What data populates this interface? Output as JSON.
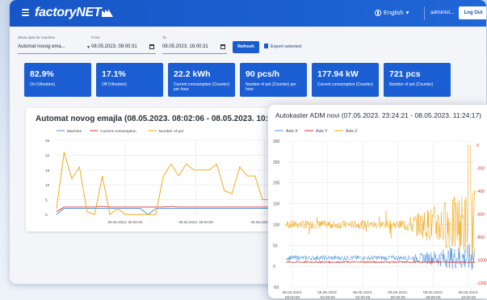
{
  "header": {
    "brand_text": "factoryNET",
    "language": "English",
    "user": "administ...",
    "logout": "Log Out"
  },
  "filters": {
    "machine": {
      "label": "Show data for machine",
      "value": "Automat novog ema..."
    },
    "from": {
      "label": "From",
      "value": "08.05.2023. 08:00:31"
    },
    "to": {
      "label": "To",
      "value": "08.05.2023. 16:00:31"
    },
    "refresh": "Refresh",
    "export": "Export selected"
  },
  "kpis": [
    {
      "value": "82.9%",
      "label": "On (Vibration)"
    },
    {
      "value": "17.1%",
      "label": "Off (Vibration)"
    },
    {
      "value": "22.2 kWh",
      "label": "Current consumption (Counter) per hour"
    },
    {
      "value": "90 pcs/h",
      "label": "Number of pot (Counter) per hour"
    },
    {
      "value": "177.94 kW",
      "label": "Current consumption (Counter)"
    },
    {
      "value": "721 pcs",
      "label": "Number of pot (Counter)"
    }
  ],
  "colors": {
    "primary": "#1b5ed4",
    "blue_series": "#4a90e2",
    "red_series": "#d9302b",
    "orange_series": "#f0a30a"
  },
  "chart_data": [
    {
      "type": "line",
      "title": "Automat novog emajla (08.05.2023. 08:02:06 - 08.05.2023. 10:20:08)",
      "series": [
        {
          "name": "Machine",
          "color": "#4a90e2",
          "values": [
            0,
            2,
            2,
            2,
            2,
            2,
            2,
            2,
            2,
            2,
            2,
            2,
            0,
            2,
            2,
            2,
            2,
            2,
            2,
            2,
            2,
            2,
            2,
            2,
            2,
            2,
            2,
            2,
            2,
            2
          ]
        },
        {
          "name": "Current consumption",
          "color": "#d9302b",
          "values": [
            1,
            2.5,
            2.5,
            2.5,
            2.5,
            2.5,
            2.7,
            2.5,
            2.5,
            2.5,
            2.5,
            2.5,
            2.5,
            2.5,
            2.5,
            2.7,
            2.5,
            2.5,
            2.5,
            2.5,
            2.5,
            2.5,
            2.5,
            2.5,
            2.5,
            2.5,
            2.5,
            2.5,
            2.5,
            2.5
          ]
        },
        {
          "name": "Number of pot",
          "color": "#f0a30a",
          "values": [
            2,
            21,
            12,
            16,
            1,
            0,
            13,
            0,
            2,
            0,
            0,
            0,
            0,
            0,
            13,
            17,
            13,
            17,
            15,
            15,
            15,
            17,
            8,
            7,
            16,
            13,
            13,
            5,
            5,
            12
          ]
        }
      ],
      "x_ticks": [
        "08.05.2023. 08:30:00",
        "08.05.2023. 09:00:00",
        "08.05.2023. 09:3"
      ],
      "ylim": [
        0,
        25
      ],
      "y_ticks": [
        0,
        5,
        10,
        15,
        20,
        25
      ]
    },
    {
      "type": "line",
      "title": "Autokaster ADM novi (07.05.2023. 23:24:21 - 08.05.2023. 11:24:17)",
      "series": [
        {
          "name": "Axis X",
          "color": "#4a90e2"
        },
        {
          "name": "Axis Y",
          "color": "#d9302b"
        },
        {
          "name": "Axis Z",
          "color": "#f0a30a"
        }
      ],
      "ylim": [
        -50,
        300
      ],
      "y_ticks": [
        -50,
        0,
        50,
        100,
        150,
        200,
        250,
        300
      ],
      "y2_ticks": [
        0,
        -200,
        -400,
        -600,
        -800,
        -1000,
        -1200
      ],
      "x_ticks": [
        "08.05.2023. 00:00:00",
        "08.05.2023. 02:00:00",
        "08.05.2023. 04:00:00",
        "08.05.2023. 06:00:00",
        "08.05.2023. 08:00:00",
        "08.05.2023. 10:00:00"
      ]
    }
  ]
}
